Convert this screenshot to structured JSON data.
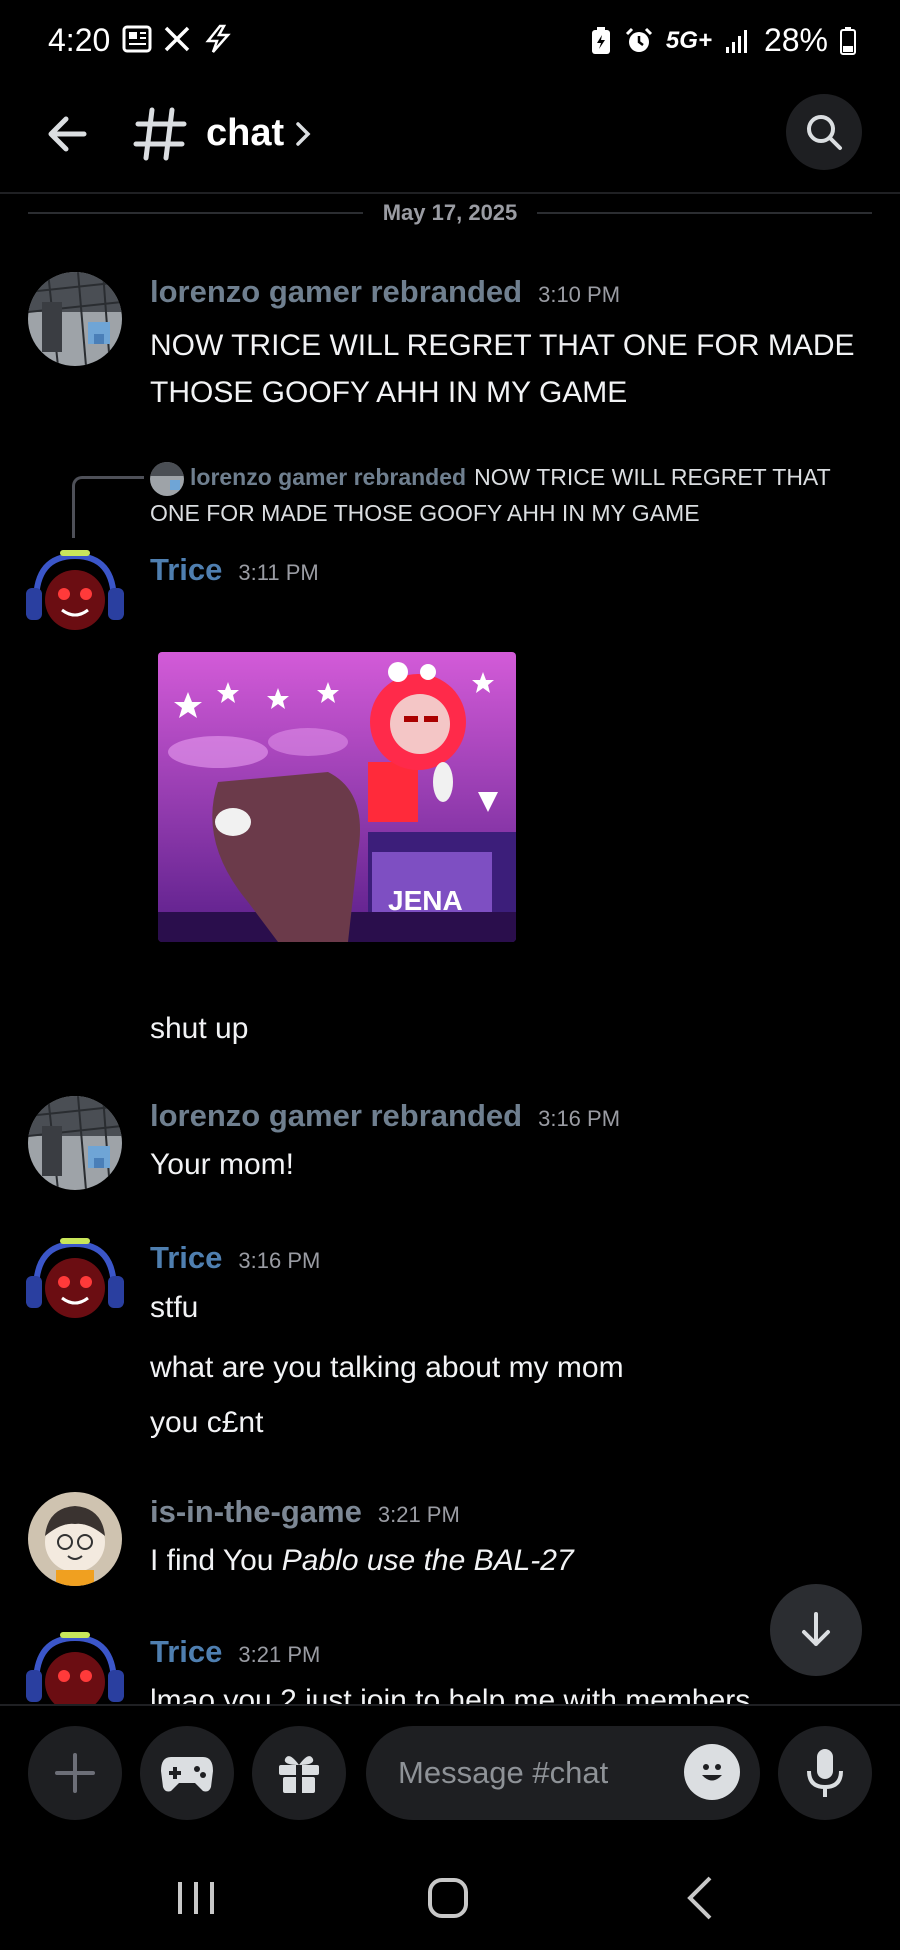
{
  "status_bar": {
    "time": "4:20",
    "network": "5G+",
    "battery": "28%"
  },
  "header": {
    "channel_name": "chat",
    "back_icon": "arrow-left-icon",
    "channel_icon": "hash-icon",
    "search_icon": "search-icon"
  },
  "date_divider": "May 17, 2025",
  "messages": [
    {
      "author": "lorenzo gamer rebranded",
      "time": "3:10 PM",
      "lines": [
        "NOW TRICE WILL REGRET THAT ONE FOR MADE",
        "THOSE GOOFY AHH IN MY GAME"
      ]
    },
    {
      "reply_author": "lorenzo gamer rebranded",
      "reply_text_1": "NOW TRICE WILL REGRET THAT",
      "reply_text_2": "ONE FOR MADE THOSE GOOFY AHH IN MY GAME",
      "author": "Trice",
      "time": "3:11 PM",
      "lines": [
        "shut up"
      ]
    },
    {
      "author": "lorenzo gamer rebranded",
      "time": "3:16 PM",
      "lines": [
        "Your mom!"
      ]
    },
    {
      "author": "Trice",
      "time": "3:16 PM",
      "lines": [
        "stfu",
        "what are you talking about my mom",
        "you c£nt"
      ]
    },
    {
      "author": "is-in-the-game",
      "time": "3:21 PM",
      "text_plain": "I find You ",
      "text_italic": "Pablo use the BAL-27"
    },
    {
      "author": "Trice",
      "time": "3:21 PM",
      "lines": [
        "lmao you 2 just join to help me with members"
      ]
    }
  ],
  "image_attachment": {
    "caption_text": "JENA"
  },
  "composer": {
    "placeholder": "Message #chat"
  },
  "colors": {
    "background": "#000000",
    "surface": "#1e1f22",
    "trice_name": "#4f7fb0",
    "lorenzo_name": "#6f7f8f"
  }
}
